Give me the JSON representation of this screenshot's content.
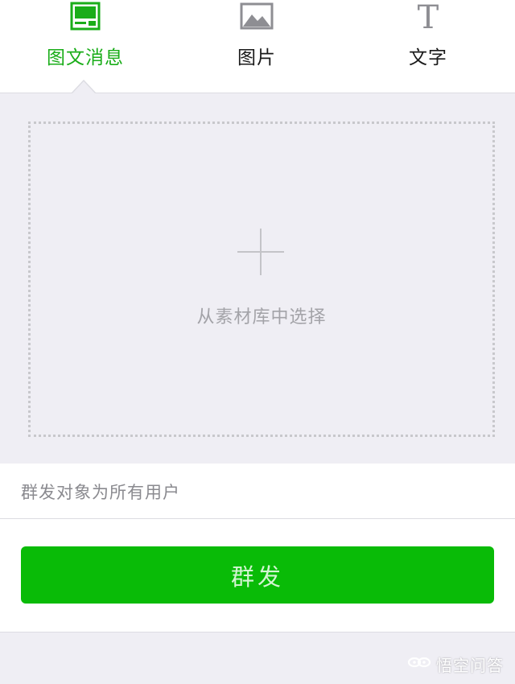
{
  "tabs": [
    {
      "label": "图文消息",
      "icon": "news-article-icon",
      "active": true
    },
    {
      "label": "图片",
      "icon": "image-icon",
      "active": false
    },
    {
      "label": "文字",
      "icon": "text-icon",
      "active": false
    }
  ],
  "text_icon_glyph": "T",
  "upload": {
    "label": "从素材库中选择",
    "icon": "plus-icon"
  },
  "recipient": {
    "label": "群发对象为所有用户"
  },
  "send_button": {
    "label": "群发"
  },
  "watermark": {
    "text": "悟空问答",
    "icon": "wukong-logo-icon"
  },
  "colors": {
    "accent": "#1aad19",
    "button": "#09bb07",
    "background": "#efeef4",
    "icon_gray": "#8e8e93"
  }
}
